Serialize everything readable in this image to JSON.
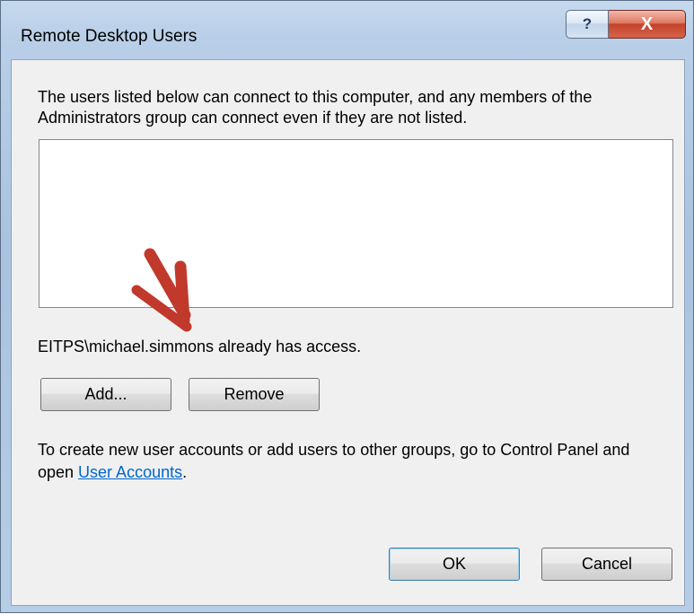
{
  "window": {
    "title": "Remote Desktop Users",
    "help_glyph": "?",
    "close_glyph": "X"
  },
  "dialog": {
    "description": "The users listed below can connect to this computer, and any members of the Administrators group can connect even if they are not listed.",
    "users": [],
    "status_message": "EITPS\\michael.simmons already has access.",
    "add_label": "Add...",
    "remove_label": "Remove",
    "help_text_before": "To create new user accounts or add users to other groups, go to Control Panel and open ",
    "help_link": "User Accounts",
    "help_text_after": ".",
    "ok_label": "OK",
    "cancel_label": "Cancel"
  },
  "annotation": {
    "arrow_color": "#c0392b",
    "icon": "red-arrow-icon"
  }
}
